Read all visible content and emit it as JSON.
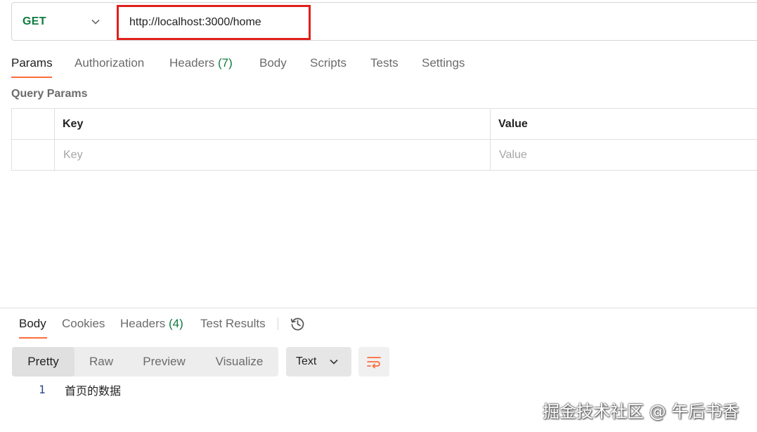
{
  "request": {
    "method": "GET",
    "url": "http://localhost:3000/home"
  },
  "request_tabs": [
    {
      "label": "Params",
      "count": "",
      "active": true
    },
    {
      "label": "Authorization",
      "count": ""
    },
    {
      "label": "Headers",
      "count": "(7)"
    },
    {
      "label": "Body",
      "count": ""
    },
    {
      "label": "Scripts",
      "count": ""
    },
    {
      "label": "Tests",
      "count": ""
    },
    {
      "label": "Settings",
      "count": ""
    }
  ],
  "query_params": {
    "title": "Query Params",
    "headers": {
      "key": "Key",
      "value": "Value"
    },
    "placeholders": {
      "key": "Key",
      "value": "Value"
    }
  },
  "response_tabs": [
    {
      "label": "Body",
      "count": "",
      "active": true
    },
    {
      "label": "Cookies",
      "count": ""
    },
    {
      "label": "Headers",
      "count": "(4)"
    },
    {
      "label": "Test Results",
      "count": ""
    }
  ],
  "view_modes": [
    "Pretty",
    "Raw",
    "Preview",
    "Visualize"
  ],
  "active_view_mode": "Pretty",
  "format_select": "Text",
  "response_body": {
    "line_number": "1",
    "text": "首页的数据"
  },
  "watermark": "掘金技术社区 @ 午后书香",
  "icons": [
    "chevron-down-icon",
    "history-icon",
    "wrap-lines-icon"
  ],
  "colors": {
    "accent": "#ff6c37",
    "method_get": "#0f7b3f",
    "highlight_border": "#e0201c"
  }
}
